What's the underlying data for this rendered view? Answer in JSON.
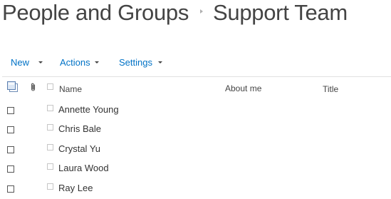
{
  "breadcrumb": {
    "parent": "People and Groups",
    "current": "Support Team"
  },
  "toolbar": {
    "new_label": "New",
    "actions_label": "Actions",
    "settings_label": "Settings"
  },
  "table": {
    "columns": {
      "name": "Name",
      "about_me": "About me",
      "title": "Title"
    },
    "rows": [
      {
        "name": "Annette Young"
      },
      {
        "name": "Chris Bale"
      },
      {
        "name": "Crystal Yu"
      },
      {
        "name": "Laura Wood"
      },
      {
        "name": "Ray Lee"
      }
    ]
  },
  "icons": {
    "multi_select": "multi-select-icon",
    "attachment": "paperclip-icon",
    "breadcrumb_separator": "triangle-right-icon",
    "dropdown": "caret-down-icon"
  },
  "colors": {
    "link": "#0072c6",
    "title_text": "#444444"
  }
}
